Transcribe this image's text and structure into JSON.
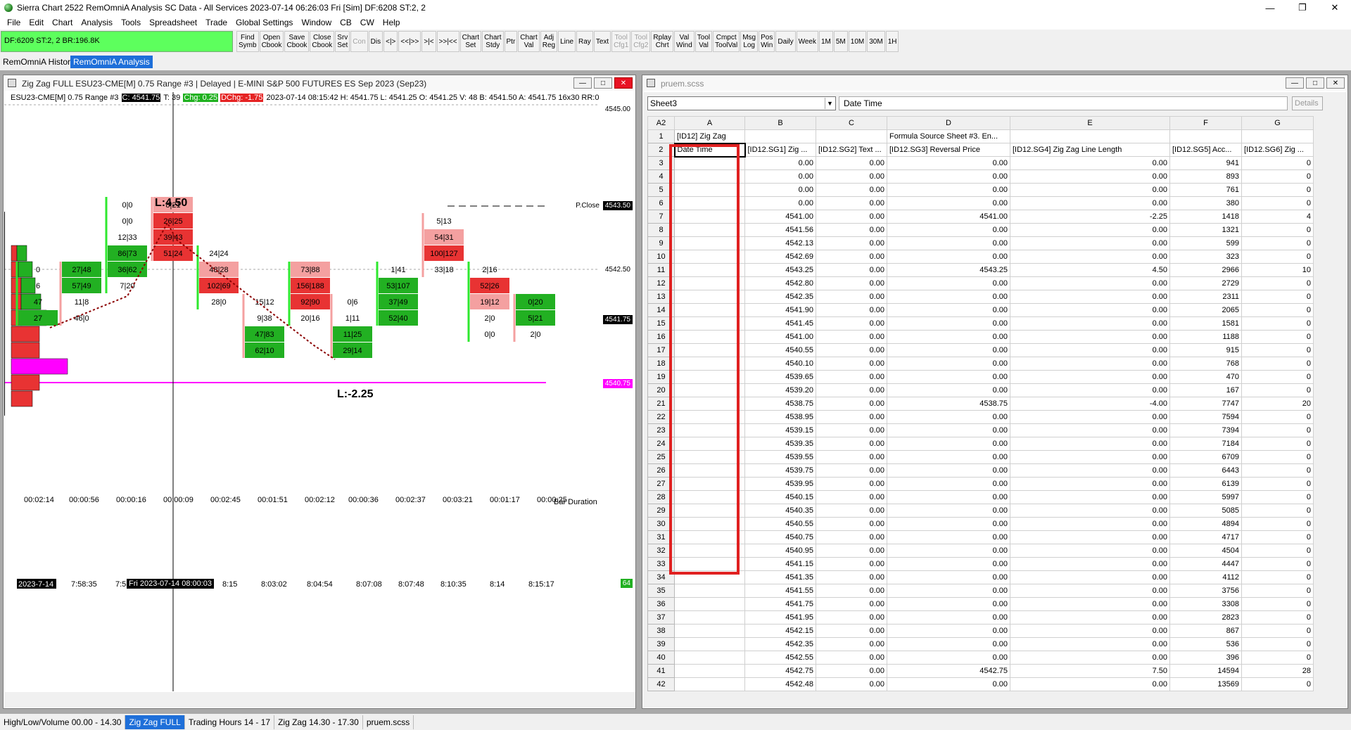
{
  "titlebar": {
    "title": "Sierra Chart 2522 RemOmniA Analysis SC Data - All Services 2023-07-14  06:26:03 Fri [Sim]  DF:6208  ST:2, 2"
  },
  "menu": [
    "File",
    "Edit",
    "Chart",
    "Analysis",
    "Tools",
    "Spreadsheet",
    "Trade",
    "Global Settings",
    "Window",
    "CB",
    "CW",
    "Help"
  ],
  "toolbar": {
    "status": "DF:6209  ST:2, 2  BR:196.8K",
    "buttons": [
      {
        "label": "Find\nSymb",
        "disabled": false
      },
      {
        "label": "Open\nCbook",
        "disabled": false
      },
      {
        "label": "Save\nCbook",
        "disabled": false
      },
      {
        "label": "Close\nCbook",
        "disabled": false
      },
      {
        "label": "Srv\nSet",
        "disabled": false
      },
      {
        "label": "Con",
        "disabled": true
      },
      {
        "label": "Dis",
        "disabled": false
      },
      {
        "label": "<|>",
        "disabled": false
      },
      {
        "label": "<<|>>",
        "disabled": false
      },
      {
        "label": ">|<",
        "disabled": false
      },
      {
        "label": ">>|<<",
        "disabled": false
      },
      {
        "label": "Chart\nSet",
        "disabled": false
      },
      {
        "label": "Chart\nStdy",
        "disabled": false
      },
      {
        "label": "Ptr",
        "disabled": false
      },
      {
        "label": "Chart\nVal",
        "disabled": false
      },
      {
        "label": "Adj\nReg",
        "disabled": false
      },
      {
        "label": "Line",
        "disabled": false
      },
      {
        "label": "Ray",
        "disabled": false
      },
      {
        "label": "Text",
        "disabled": false
      },
      {
        "label": "Tool\nCfg1",
        "disabled": true
      },
      {
        "label": "Tool\nCfg2",
        "disabled": true
      },
      {
        "label": "Rplay\nChrt",
        "disabled": false
      },
      {
        "label": "Val\nWind",
        "disabled": false
      },
      {
        "label": "Tool\nVal",
        "disabled": false
      },
      {
        "label": "Cmpct\nToolVal",
        "disabled": false
      },
      {
        "label": "Msg\nLog",
        "disabled": false
      },
      {
        "label": "Pos\nWin",
        "disabled": false
      },
      {
        "label": "Daily",
        "disabled": false
      },
      {
        "label": "Week",
        "disabled": false
      },
      {
        "label": "1M",
        "disabled": false
      },
      {
        "label": "5M",
        "disabled": false
      },
      {
        "label": "10M",
        "disabled": false
      },
      {
        "label": "30M",
        "disabled": false
      },
      {
        "label": "1H",
        "disabled": false
      }
    ]
  },
  "workspace_tabs": [
    {
      "label": "RemOmniA Historical",
      "active": false
    },
    {
      "label": "RemOmniA Analysis",
      "active": true
    }
  ],
  "chart_window": {
    "title": "Zig Zag FULL ESU23-CME[M]  0.75 Range #3 | Delayed | E-MINI S&P 500 FUTURES ES Sep 2023 (Sep23)",
    "info": {
      "symbol": "ESU23-CME[M]  0.75 Range #3",
      "close": "C: 4541.75",
      "t": "T: 39",
      "chg": "Chg: 0.25",
      "dchg": "DChg: -1.75",
      "rest": "2023-07-14 08:15:42 H: 4541.75 L: 4541.25 O: 4541.25 V: 48 B: 4541.50 A: 4541.75 16x30 RR:0"
    },
    "price_labels": {
      "top": "4545.00",
      "pclose_text": "P.Close",
      "pclose": "4543.50",
      "mid": "4542.50",
      "last": "4541.75",
      "poc": "4540.75"
    },
    "zigzag_labels": {
      "high": "L:4.50",
      "low": "L:-2.25"
    },
    "bar_duration_label": "Bar Duration",
    "durations": [
      "00:02:14",
      "00:00:56",
      "00:00:16",
      "00:00:09",
      "00:02:45",
      "00:01:51",
      "00:02:12",
      "00:00:36",
      "00:02:37",
      "00:03:21",
      "00:01:17",
      "00:00:25"
    ],
    "time_labels": [
      "2023-7-14",
      "7:58:35",
      "7:5",
      "8:15",
      "8:03:02",
      "8:04:54",
      "8:07:08",
      "8:07:48",
      "8:10:35",
      "8:14",
      "8:15:17"
    ],
    "cursor_time": "Fri 2023-07-14  08:00:03",
    "corner_value": "64",
    "bars": [
      {
        "cells": [
          {
            "row": 10,
            "text": "0",
            "side": "none"
          },
          {
            "row": 11,
            "text": "6",
            "side": "none"
          },
          {
            "row": 12,
            "text": "47",
            "side": "none"
          },
          {
            "row": 13,
            "text": "27",
            "side": "buy"
          }
        ]
      },
      {
        "cells": [
          {
            "row": 10,
            "text": "27|48",
            "side": "buy"
          },
          {
            "row": 11,
            "text": "57|49",
            "side": "buy"
          },
          {
            "row": 12,
            "text": "11|8",
            "side": "none"
          },
          {
            "row": 13,
            "text": "46|0",
            "side": "none"
          }
        ]
      },
      {
        "cells": [
          {
            "row": 6,
            "text": "0|0",
            "side": "none"
          },
          {
            "row": 7,
            "text": "0|0",
            "side": "none"
          },
          {
            "row": 8,
            "text": "12|33",
            "side": "none"
          },
          {
            "row": 9,
            "text": "86|73",
            "side": "buy"
          },
          {
            "row": 10,
            "text": "36|62",
            "side": "buy"
          },
          {
            "row": 11,
            "text": "7|20",
            "side": "none"
          }
        ]
      },
      {
        "cells": [
          {
            "row": 6,
            "text": "8|21",
            "side": "sell-light"
          },
          {
            "row": 7,
            "text": "26|25",
            "side": "sell"
          },
          {
            "row": 8,
            "text": "39|43",
            "side": "sell"
          },
          {
            "row": 9,
            "text": "51|24",
            "side": "sell"
          }
        ]
      },
      {
        "cells": [
          {
            "row": 9,
            "text": "24|24",
            "side": "none"
          },
          {
            "row": 10,
            "text": "48|28",
            "side": "sell-light"
          },
          {
            "row": 11,
            "text": "102|69",
            "side": "sell"
          },
          {
            "row": 12,
            "text": "28|0",
            "side": "none"
          }
        ]
      },
      {
        "cells": [
          {
            "row": 12,
            "text": "15|12",
            "side": "none"
          },
          {
            "row": 13,
            "text": "9|38",
            "side": "none"
          },
          {
            "row": 14,
            "text": "47|83",
            "side": "buy"
          },
          {
            "row": 15,
            "text": "62|10",
            "side": "buy"
          }
        ]
      },
      {
        "cells": [
          {
            "row": 10,
            "text": "73|88",
            "side": "sell-light"
          },
          {
            "row": 11,
            "text": "156|188",
            "side": "sell"
          },
          {
            "row": 12,
            "text": "92|90",
            "side": "sell"
          },
          {
            "row": 13,
            "text": "20|16",
            "side": "none"
          }
        ]
      },
      {
        "cells": [
          {
            "row": 12,
            "text": "0|6",
            "side": "none"
          },
          {
            "row": 13,
            "text": "1|11",
            "side": "none"
          },
          {
            "row": 14,
            "text": "11|25",
            "side": "buy"
          },
          {
            "row": 15,
            "text": "29|14",
            "side": "buy"
          }
        ]
      },
      {
        "cells": [
          {
            "row": 10,
            "text": "1|41",
            "side": "none"
          },
          {
            "row": 11,
            "text": "53|107",
            "side": "buy"
          },
          {
            "row": 12,
            "text": "37|49",
            "side": "buy"
          },
          {
            "row": 13,
            "text": "52|40",
            "side": "buy"
          }
        ]
      },
      {
        "cells": [
          {
            "row": 7,
            "text": "5|13",
            "side": "none"
          },
          {
            "row": 8,
            "text": "54|31",
            "side": "sell-light"
          },
          {
            "row": 9,
            "text": "100|127",
            "side": "sell"
          },
          {
            "row": 10,
            "text": "33|18",
            "side": "none"
          }
        ]
      },
      {
        "cells": [
          {
            "row": 10,
            "text": "2|16",
            "side": "none"
          },
          {
            "row": 11,
            "text": "52|26",
            "side": "sell"
          },
          {
            "row": 12,
            "text": "19|12",
            "side": "sell-light"
          },
          {
            "row": 13,
            "text": "2|0",
            "side": "none"
          },
          {
            "row": 14,
            "text": "0|0",
            "side": "none"
          }
        ]
      },
      {
        "cells": [
          {
            "row": 12,
            "text": "0|20",
            "side": "buy"
          },
          {
            "row": 13,
            "text": "5|21",
            "side": "buy"
          },
          {
            "row": 14,
            "text": "2|0",
            "side": "none"
          }
        ]
      }
    ],
    "volume_profile": [
      {
        "row": 9,
        "buy": 14,
        "sell": 8
      },
      {
        "row": 10,
        "buy": 20,
        "sell": 10
      },
      {
        "row": 11,
        "buy": 20,
        "sell": 14
      },
      {
        "row": 12,
        "buy": 28,
        "sell": 14
      },
      {
        "row": 13,
        "buy": 36,
        "sell": 14
      },
      {
        "row": 14,
        "buy": 0,
        "sell": 40
      },
      {
        "row": 15,
        "buy": 0,
        "sell": 40
      },
      {
        "row": 16,
        "buy": 0,
        "sell": 0,
        "poc": true
      },
      {
        "row": 17,
        "buy": 0,
        "sell": 40
      },
      {
        "row": 18,
        "buy": 0,
        "sell": 30
      }
    ],
    "colors": {
      "buy": "#22b022",
      "buy_light": "#2ee82e",
      "sell": "#e83333",
      "sell_light": "#f4a0a0",
      "poc": "#ff00ff",
      "zigzag": "#8b0000"
    }
  },
  "sheet_window": {
    "title": "pruem.scss",
    "sheet_select": "Sheet3",
    "cell_ref": "A2",
    "formula": "Date Time",
    "details_label": "Details",
    "col_headers": [
      "A",
      "B",
      "C",
      "D",
      "E",
      "F",
      "G"
    ],
    "row1": [
      "[ID12] Zig Zag",
      "",
      "",
      "Formula Source Sheet #3.  En...",
      "",
      "",
      ""
    ],
    "row2": [
      "Date Time",
      "[ID12.SG1] Zig ...",
      "[ID12.SG2] Text ...",
      "[ID12.SG3] Reversal Price",
      "[ID12.SG4] Zig Zag Line Length",
      "[ID12.SG5] Acc...",
      "[ID12.SG6] Zig ..."
    ],
    "rows": [
      [
        "",
        "0.00",
        "0.00",
        "0.00",
        "0.00",
        "941",
        "0"
      ],
      [
        "",
        "0.00",
        "0.00",
        "0.00",
        "0.00",
        "893",
        "0"
      ],
      [
        "",
        "0.00",
        "0.00",
        "0.00",
        "0.00",
        "761",
        "0"
      ],
      [
        "",
        "0.00",
        "0.00",
        "0.00",
        "0.00",
        "380",
        "0"
      ],
      [
        "",
        "4541.00",
        "0.00",
        "4541.00",
        "-2.25",
        "1418",
        "4"
      ],
      [
        "",
        "4541.56",
        "0.00",
        "0.00",
        "0.00",
        "1321",
        "0"
      ],
      [
        "",
        "4542.13",
        "0.00",
        "0.00",
        "0.00",
        "599",
        "0"
      ],
      [
        "",
        "4542.69",
        "0.00",
        "0.00",
        "0.00",
        "323",
        "0"
      ],
      [
        "",
        "4543.25",
        "0.00",
        "4543.25",
        "4.50",
        "2966",
        "10"
      ],
      [
        "",
        "4542.80",
        "0.00",
        "0.00",
        "0.00",
        "2729",
        "0"
      ],
      [
        "",
        "4542.35",
        "0.00",
        "0.00",
        "0.00",
        "2311",
        "0"
      ],
      [
        "",
        "4541.90",
        "0.00",
        "0.00",
        "0.00",
        "2065",
        "0"
      ],
      [
        "",
        "4541.45",
        "0.00",
        "0.00",
        "0.00",
        "1581",
        "0"
      ],
      [
        "",
        "4541.00",
        "0.00",
        "0.00",
        "0.00",
        "1188",
        "0"
      ],
      [
        "",
        "4540.55",
        "0.00",
        "0.00",
        "0.00",
        "915",
        "0"
      ],
      [
        "",
        "4540.10",
        "0.00",
        "0.00",
        "0.00",
        "768",
        "0"
      ],
      [
        "",
        "4539.65",
        "0.00",
        "0.00",
        "0.00",
        "470",
        "0"
      ],
      [
        "",
        "4539.20",
        "0.00",
        "0.00",
        "0.00",
        "167",
        "0"
      ],
      [
        "",
        "4538.75",
        "0.00",
        "4538.75",
        "-4.00",
        "7747",
        "20"
      ],
      [
        "",
        "4538.95",
        "0.00",
        "0.00",
        "0.00",
        "7594",
        "0"
      ],
      [
        "",
        "4539.15",
        "0.00",
        "0.00",
        "0.00",
        "7394",
        "0"
      ],
      [
        "",
        "4539.35",
        "0.00",
        "0.00",
        "0.00",
        "7184",
        "0"
      ],
      [
        "",
        "4539.55",
        "0.00",
        "0.00",
        "0.00",
        "6709",
        "0"
      ],
      [
        "",
        "4539.75",
        "0.00",
        "0.00",
        "0.00",
        "6443",
        "0"
      ],
      [
        "",
        "4539.95",
        "0.00",
        "0.00",
        "0.00",
        "6139",
        "0"
      ],
      [
        "",
        "4540.15",
        "0.00",
        "0.00",
        "0.00",
        "5997",
        "0"
      ],
      [
        "",
        "4540.35",
        "0.00",
        "0.00",
        "0.00",
        "5085",
        "0"
      ],
      [
        "",
        "4540.55",
        "0.00",
        "0.00",
        "0.00",
        "4894",
        "0"
      ],
      [
        "",
        "4540.75",
        "0.00",
        "0.00",
        "0.00",
        "4717",
        "0"
      ],
      [
        "",
        "4540.95",
        "0.00",
        "0.00",
        "0.00",
        "4504",
        "0"
      ],
      [
        "",
        "4541.15",
        "0.00",
        "0.00",
        "0.00",
        "4447",
        "0"
      ],
      [
        "",
        "4541.35",
        "0.00",
        "0.00",
        "0.00",
        "4112",
        "0"
      ],
      [
        "",
        "4541.55",
        "0.00",
        "0.00",
        "0.00",
        "3756",
        "0"
      ],
      [
        "",
        "4541.75",
        "0.00",
        "0.00",
        "0.00",
        "3308",
        "0"
      ],
      [
        "",
        "4541.95",
        "0.00",
        "0.00",
        "0.00",
        "2823",
        "0"
      ],
      [
        "",
        "4542.15",
        "0.00",
        "0.00",
        "0.00",
        "867",
        "0"
      ],
      [
        "",
        "4542.35",
        "0.00",
        "0.00",
        "0.00",
        "536",
        "0"
      ],
      [
        "",
        "4542.55",
        "0.00",
        "0.00",
        "0.00",
        "396",
        "0"
      ],
      [
        "",
        "4542.75",
        "0.00",
        "4542.75",
        "7.50",
        "14594",
        "28"
      ],
      [
        "",
        "4542.48",
        "0.00",
        "0.00",
        "0.00",
        "13569",
        "0"
      ]
    ]
  },
  "bottom_tabs": [
    {
      "label": "High/Low/Volume 00.00 - 14.30",
      "active": false
    },
    {
      "label": "Zig Zag FULL",
      "active": true
    },
    {
      "label": "Trading Hours 14 - 17",
      "active": false
    },
    {
      "label": "Zig Zag 14.30 - 17.30",
      "active": false
    },
    {
      "label": "pruem.scss",
      "active": false
    }
  ]
}
